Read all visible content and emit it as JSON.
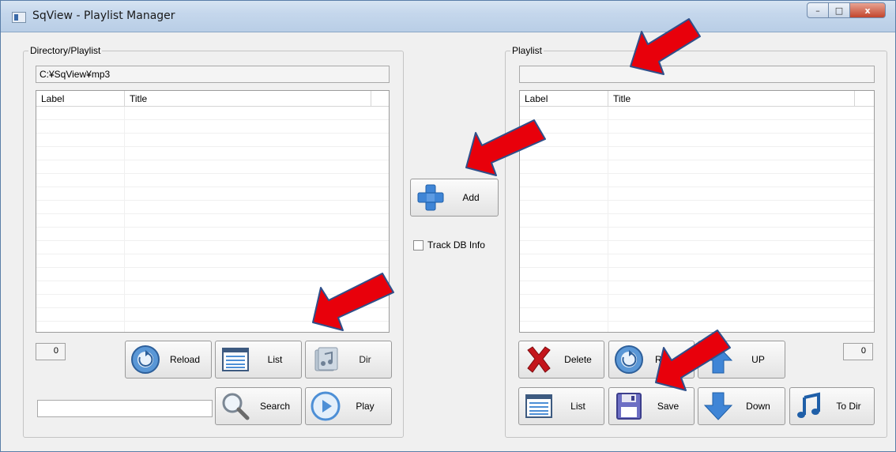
{
  "window": {
    "title": "SqView - Playlist Manager",
    "controls": [
      "–",
      "□",
      "x"
    ]
  },
  "left_panel": {
    "group_label": "Directory/Playlist",
    "path_value": "C:¥SqView¥mp3",
    "columns": [
      "Label",
      "Title"
    ],
    "count": "0",
    "search_value": "",
    "buttons": {
      "reload": "Reload",
      "list": "List",
      "dir": "Dir",
      "search": "Search",
      "play": "Play"
    }
  },
  "middle": {
    "add_label": "Add",
    "track_db_label": "Track DB Info",
    "track_db_checked": false
  },
  "right_panel": {
    "group_label": "Playlist",
    "name_value": "",
    "columns": [
      "Label",
      "Title"
    ],
    "count": "0",
    "buttons": {
      "delete": "Delete",
      "reload": "R",
      "up": "UP",
      "list": "List",
      "save": "Save",
      "down": "Down",
      "to_dir": "To Dir"
    }
  },
  "colors": {
    "annotation_arrow": "#e8000b",
    "arrow_outline": "#2f4f8a"
  }
}
